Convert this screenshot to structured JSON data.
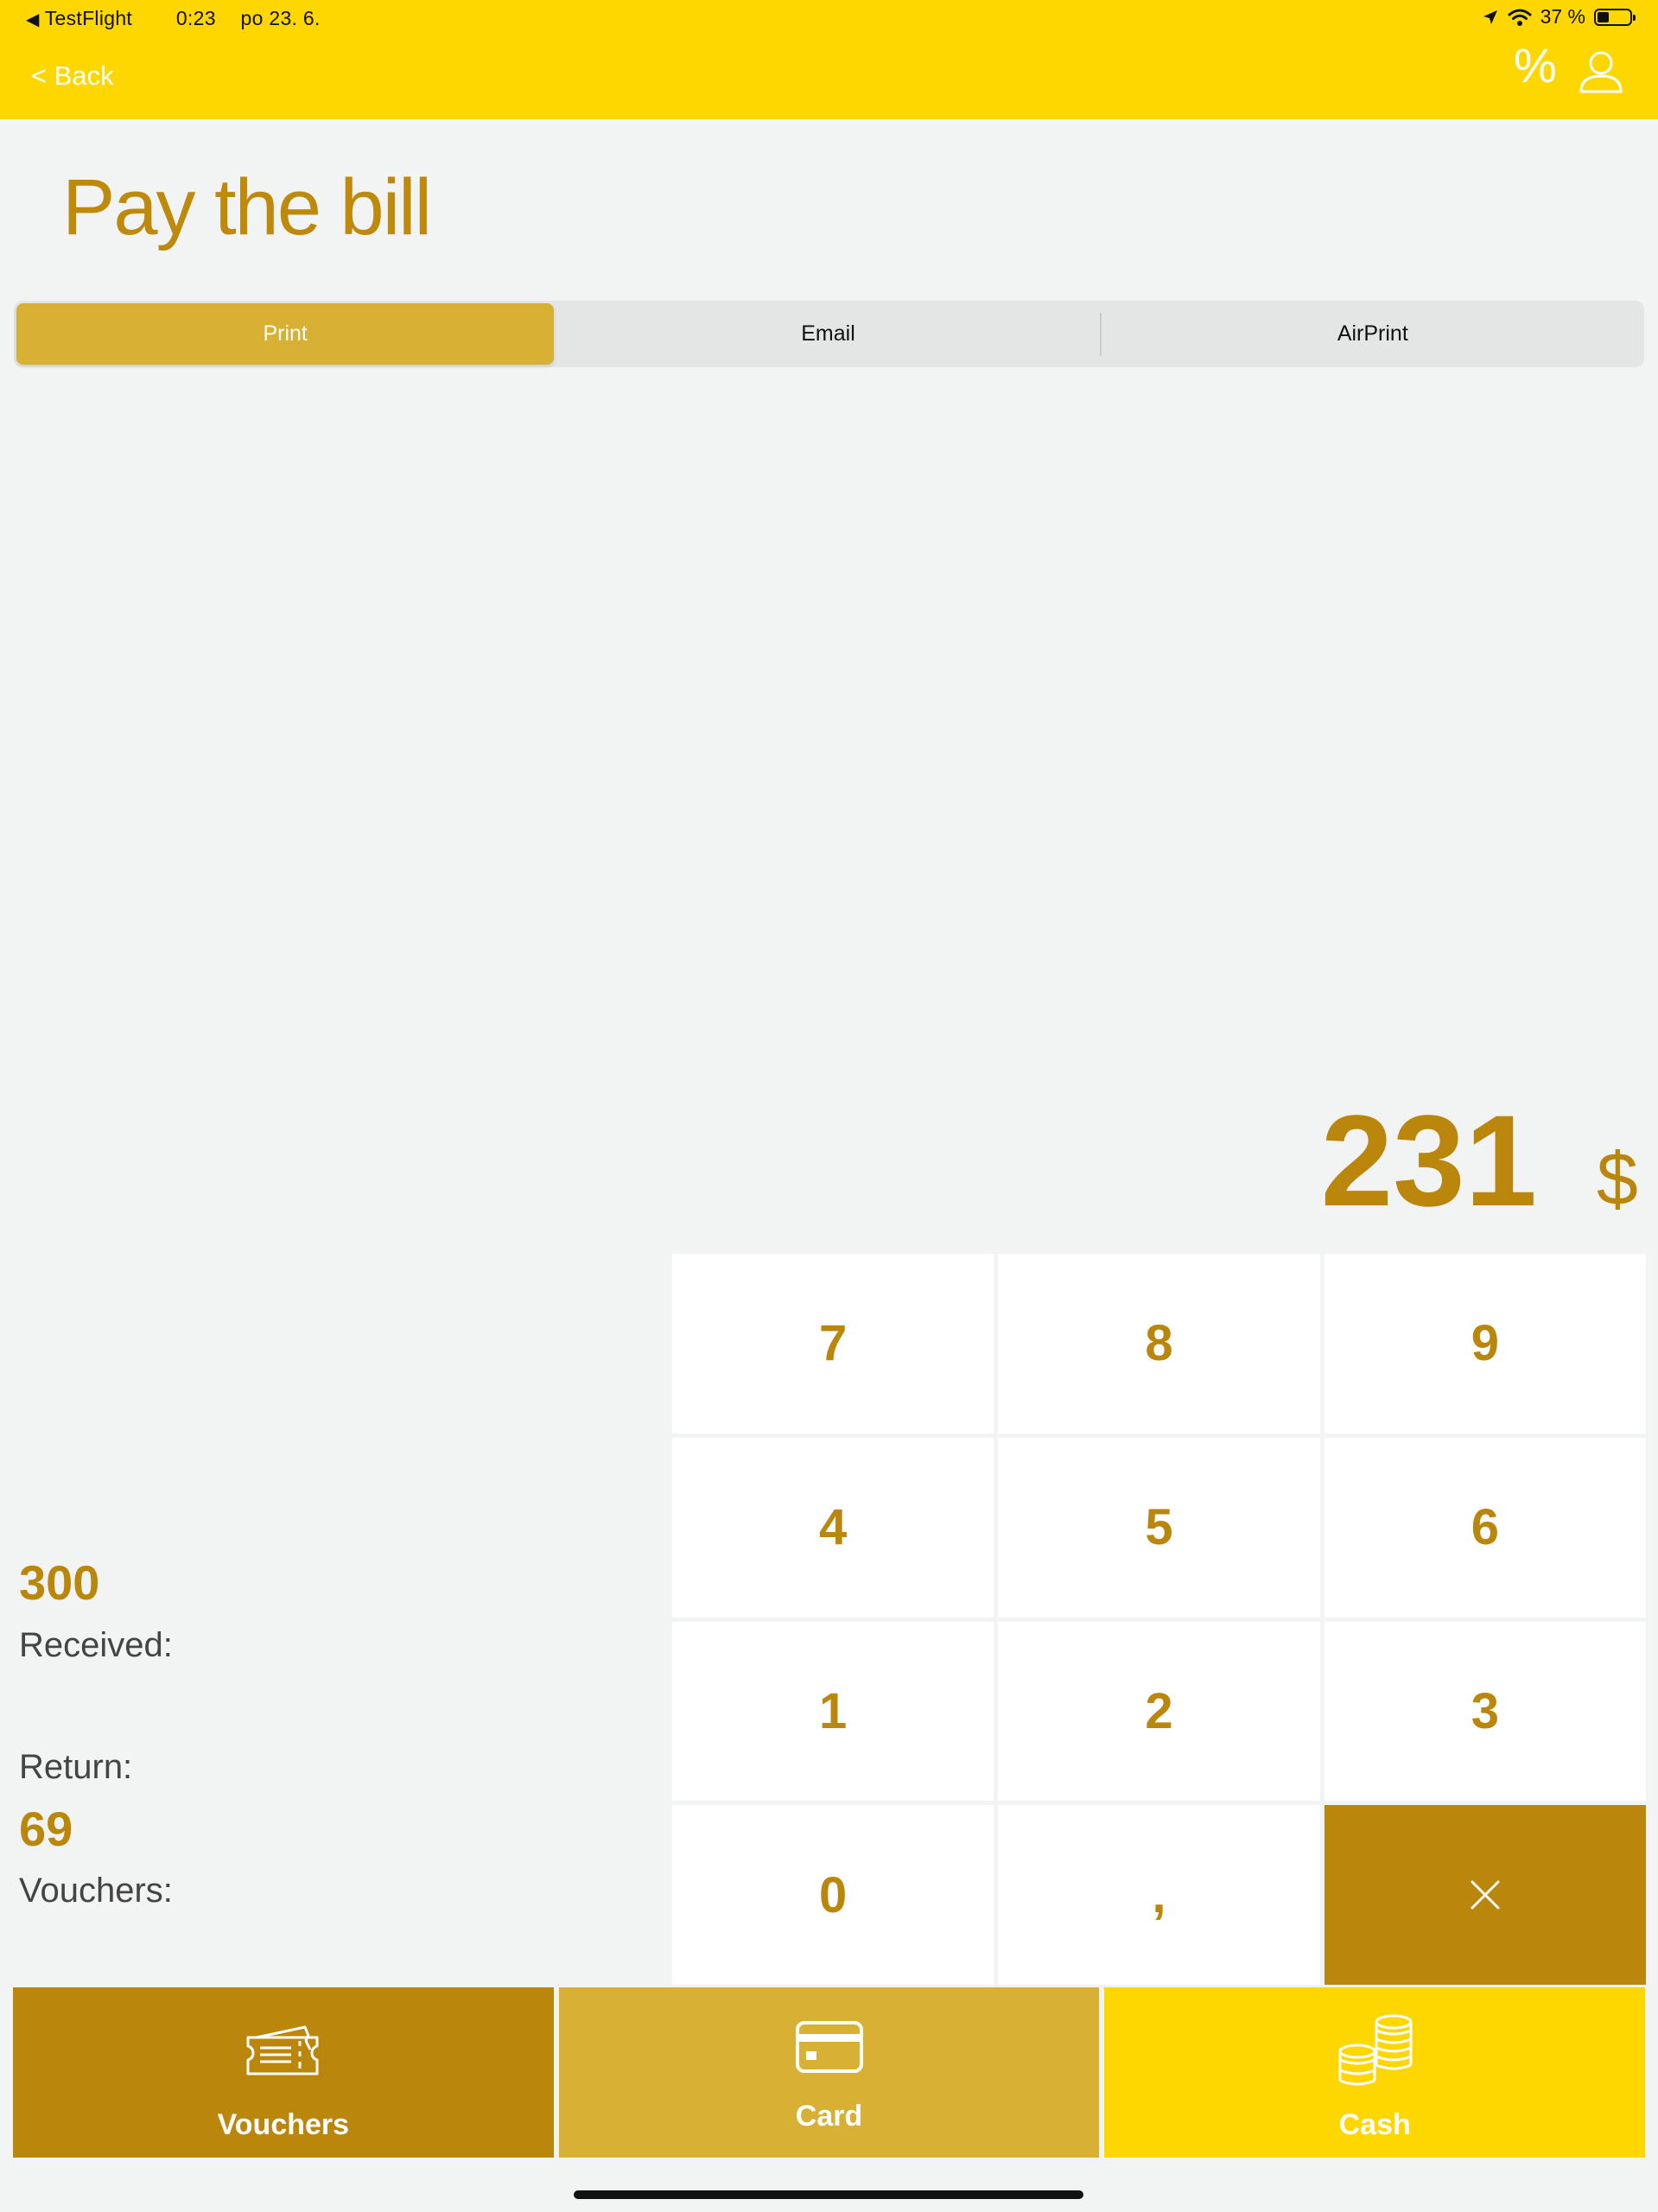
{
  "status_bar": {
    "source_app": "TestFlight",
    "time": "0:23",
    "date": "po 23. 6.",
    "battery_text": "37 %",
    "battery_level": 0.37
  },
  "nav": {
    "back_label": "< Back",
    "discount_symbol": "%"
  },
  "page": {
    "title": "Pay the bill"
  },
  "receipt_options": [
    {
      "label": "Print",
      "selected": true
    },
    {
      "label": "Email",
      "selected": false
    },
    {
      "label": "AirPrint",
      "selected": false
    }
  ],
  "amount": {
    "value": "231",
    "currency": "$"
  },
  "keypad": {
    "keys": [
      "7",
      "8",
      "9",
      "4",
      "5",
      "6",
      "1",
      "2",
      "3",
      "0",
      ",",
      "×"
    ]
  },
  "summary": {
    "received_value": "300",
    "received_label": "Received:",
    "return_label": "Return:",
    "return_value": "69",
    "vouchers_label": "Vouchers:"
  },
  "payment_methods": {
    "vouchers": "Vouchers",
    "card": "Card",
    "cash": "Cash"
  },
  "colors": {
    "brand_yellow": "#fed700",
    "gold_dark": "#bb860c",
    "gold_mid": "#d7b034",
    "background": "#f2f4f3"
  }
}
